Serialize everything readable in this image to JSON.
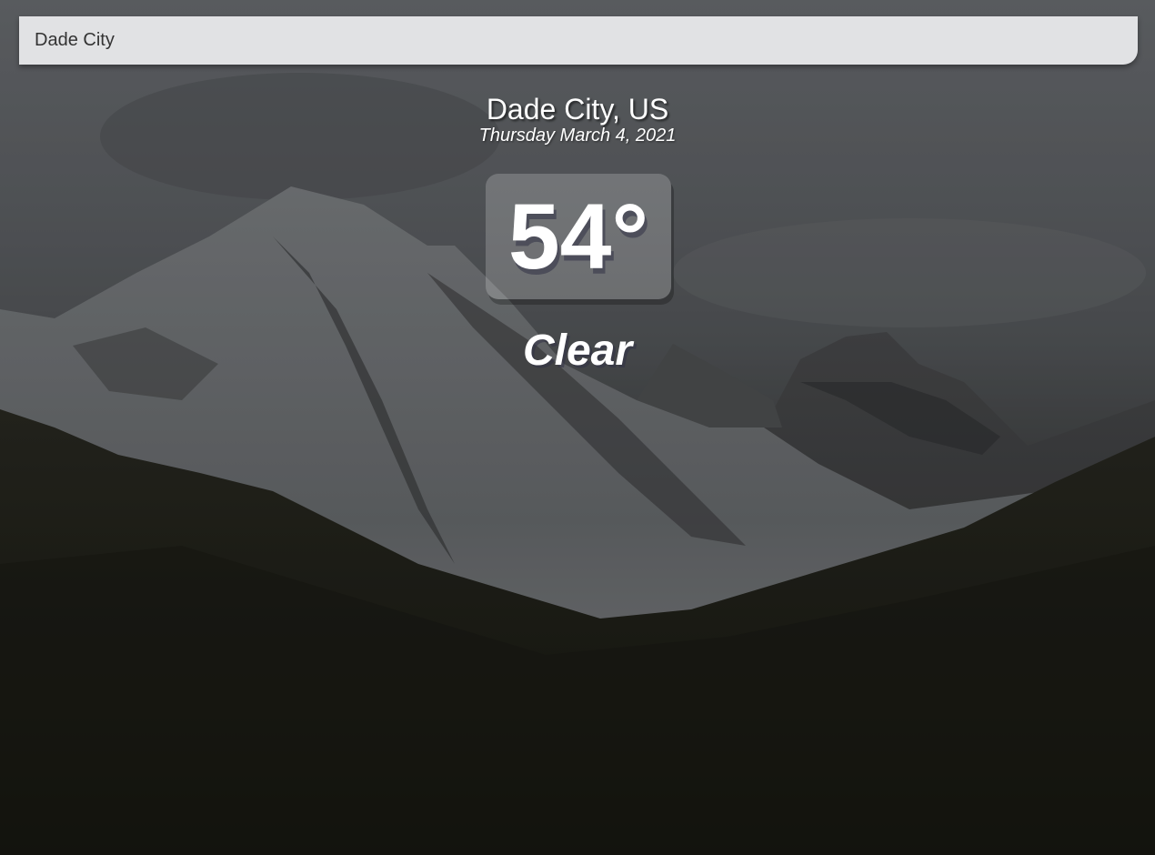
{
  "search": {
    "value": "Dade City"
  },
  "location": {
    "name": "Dade City, US",
    "date": "Thursday March 4, 2021"
  },
  "weather": {
    "temperature": "54°",
    "condition": "Clear"
  },
  "theme": {
    "text_color": "#ffffff",
    "search_bg": "#ecedef"
  }
}
